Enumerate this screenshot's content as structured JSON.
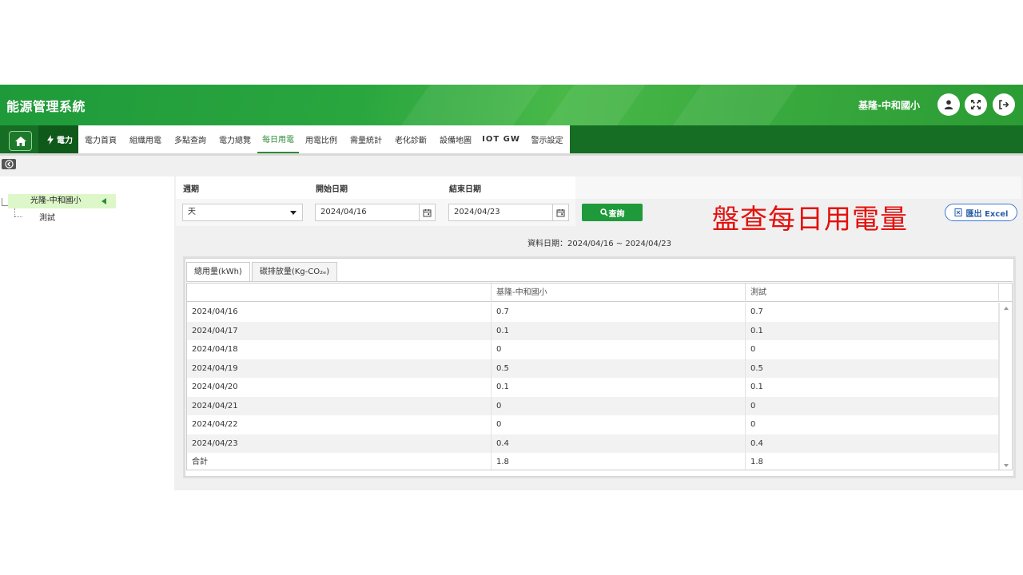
{
  "header": {
    "app_title": "能源管理系統",
    "site_name": "基隆-中和國小",
    "icons": [
      "user-icon",
      "fullscreen-icon",
      "logout-icon"
    ]
  },
  "nav": {
    "home_icon": "home-icon",
    "category": "電力",
    "tabs": [
      {
        "label": "電力首頁",
        "active": false
      },
      {
        "label": "組織用電",
        "active": false
      },
      {
        "label": "多點查詢",
        "active": false
      },
      {
        "label": "電力總覽",
        "active": false
      },
      {
        "label": "每日用電",
        "active": true
      },
      {
        "label": "用電比例",
        "active": false
      },
      {
        "label": "需量統計",
        "active": false
      },
      {
        "label": "老化診斷",
        "active": false
      },
      {
        "label": "設備地圖",
        "active": false
      },
      {
        "label": "IOT GW",
        "active": false
      },
      {
        "label": "警示設定",
        "active": false
      }
    ]
  },
  "sidebar": {
    "root": "光隆-中和國小",
    "child": "測試"
  },
  "filters": {
    "period_label": "週期",
    "period_value": "天",
    "start_label": "開始日期",
    "start_value": "2024/04/16",
    "end_label": "結束日期",
    "end_value": "2024/04/23",
    "search_label": "查詢",
    "export_label": "匯出 Excel"
  },
  "annotation": "盤查每日用電量",
  "data_date": "資料日期：2024/04/16 ~ 2024/04/23",
  "tabs": [
    {
      "label": "總用量(kWh)",
      "active": true
    },
    {
      "label": "碳排放量(Kg-CO₂ₑ)",
      "active": false
    }
  ],
  "table": {
    "columns": [
      "",
      "基隆-中和國小",
      "測試"
    ],
    "rows": [
      [
        "2024/04/16",
        "0.7",
        "0.7"
      ],
      [
        "2024/04/17",
        "0.1",
        "0.1"
      ],
      [
        "2024/04/18",
        "0",
        "0"
      ],
      [
        "2024/04/19",
        "0.5",
        "0.5"
      ],
      [
        "2024/04/20",
        "0.1",
        "0.1"
      ],
      [
        "2024/04/21",
        "0",
        "0"
      ],
      [
        "2024/04/22",
        "0",
        "0"
      ],
      [
        "2024/04/23",
        "0.4",
        "0.4"
      ],
      [
        "合計",
        "1.8",
        "1.8"
      ]
    ]
  },
  "colors": {
    "header_green": "#2aa63f",
    "nav_green": "#166e24",
    "active_tab": "#2e8b3a",
    "search_button": "#1f9a3a",
    "annotation_red": "#e3110e",
    "export_blue": "#3a7bd5"
  }
}
